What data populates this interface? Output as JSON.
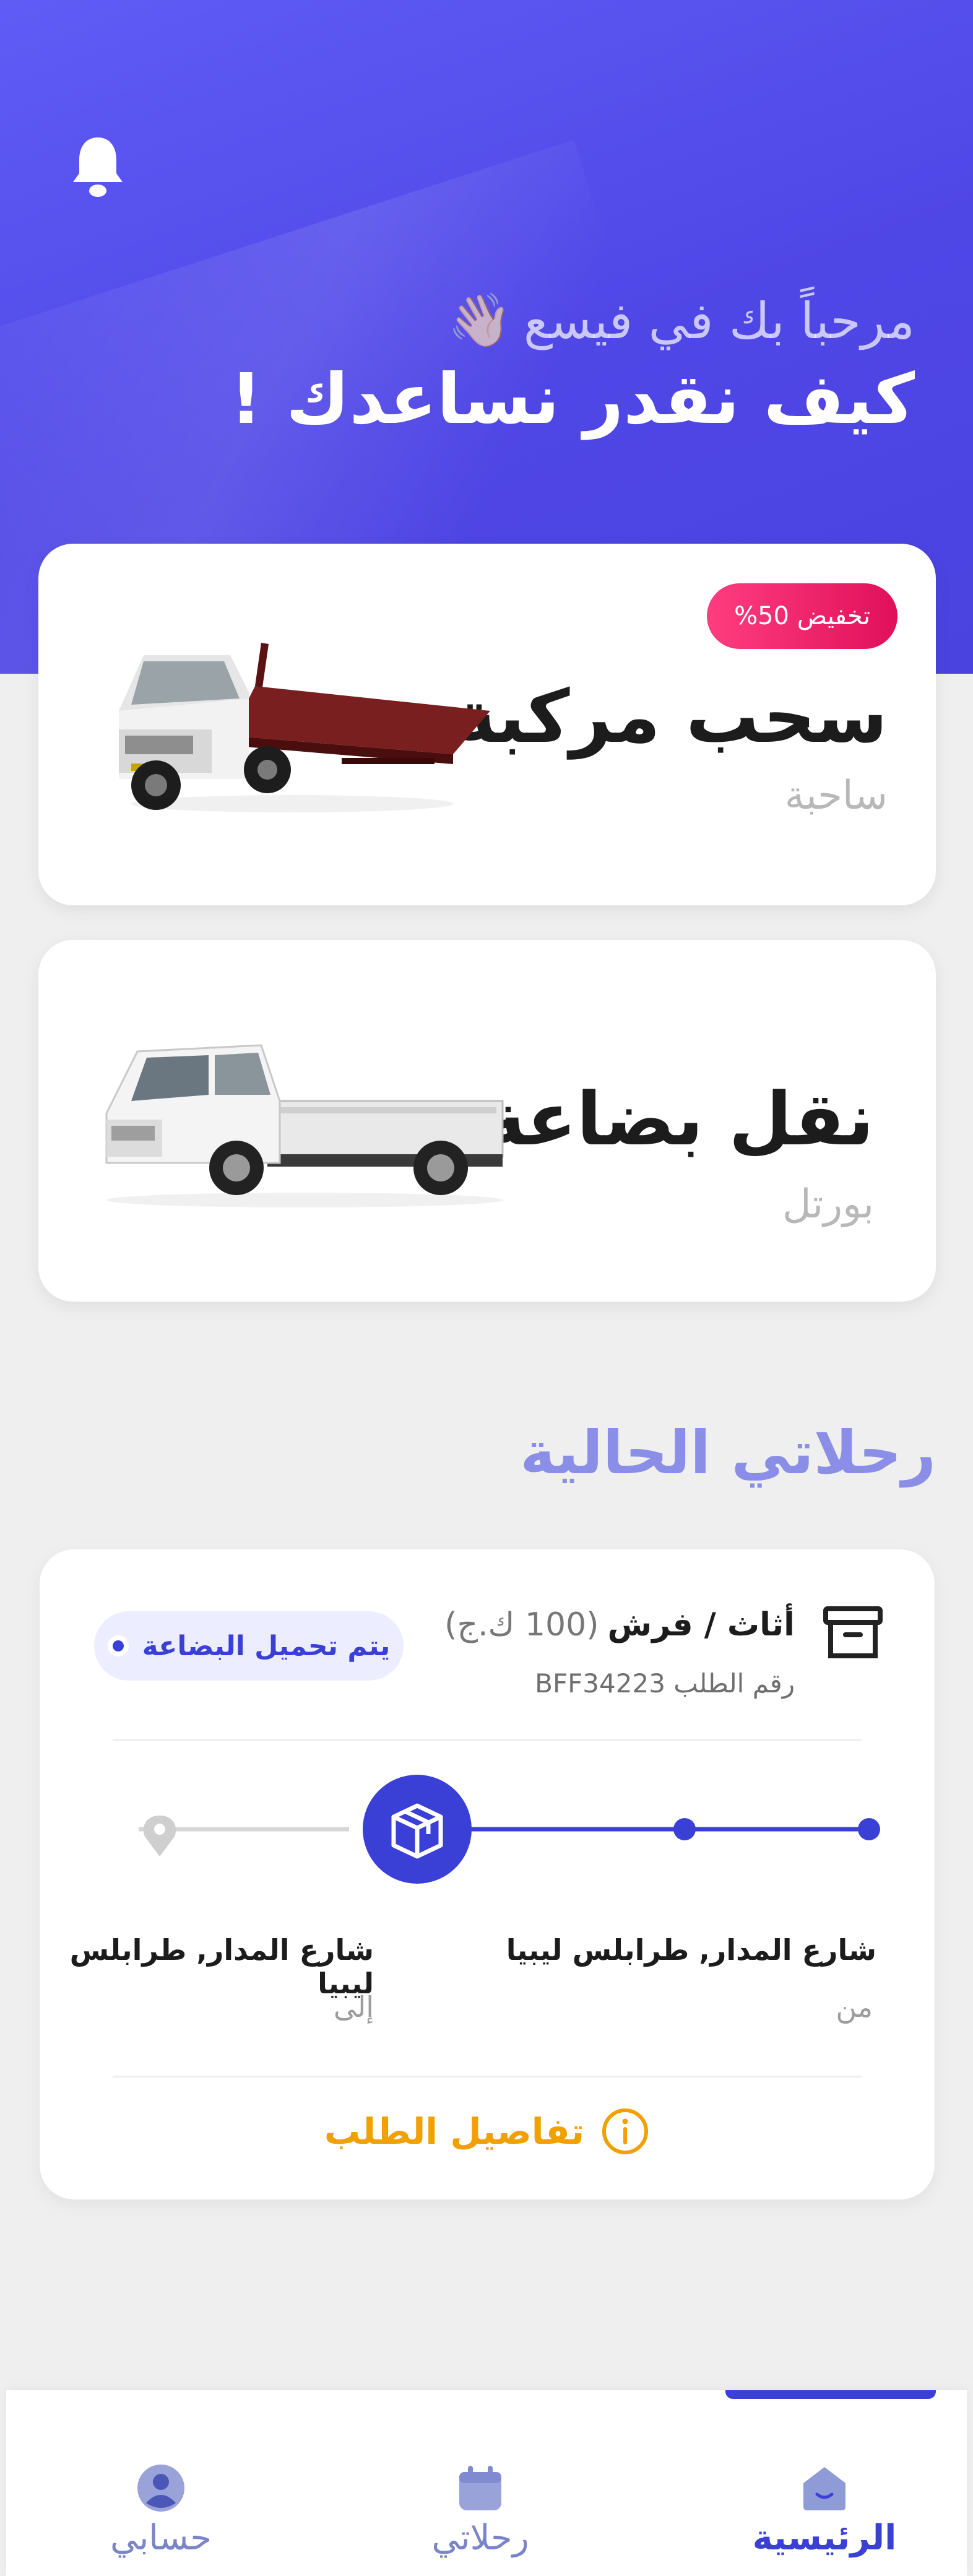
{
  "header": {
    "greeting": "مرحباً بك في فيسع",
    "wave": "👋🏻",
    "headline": "كيف نقدر نساعدك !"
  },
  "services": [
    {
      "title": "سحب مركبة",
      "subtitle": "ساحبة",
      "badge": "تخفيض 50%",
      "icon": "flatbed-tow-truck-image"
    },
    {
      "title": "نقل بضاعة",
      "subtitle": "بورتل",
      "icon": "pickup-truck-image"
    }
  ],
  "current_trips": {
    "title": "رحلاتي الحالية",
    "trip": {
      "item": "أثاث / فرش",
      "weight": "(100 ك.ج)",
      "order_label": "رقم الطلب BFF34223",
      "status": "يتم تحميل البضاعة",
      "progress": 0.5,
      "from_address": "شارع المدار, طرابلس ليبيا",
      "from_label": "من",
      "to_address": "شارع المدار, طرابلس ليبيا",
      "to_label": "إلى",
      "details_label": "تفاصيل الطلب"
    }
  },
  "nav": {
    "home": "الرئيسية",
    "trips": "رحلاتي",
    "account": "حسابي",
    "active": "home"
  },
  "colors": {
    "primary": "#3a3fd6",
    "header": "#5550ee",
    "discount": "#e0105a",
    "details": "#f0a000"
  }
}
